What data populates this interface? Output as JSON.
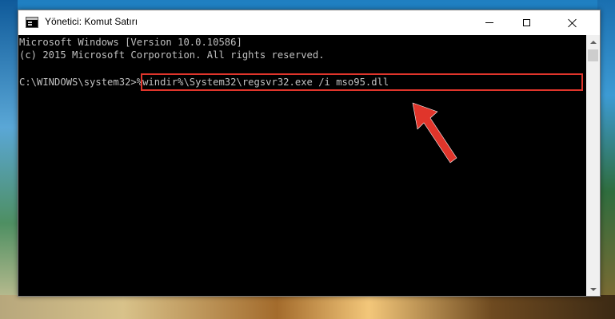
{
  "window": {
    "title": "Yönetici: Komut Satırı"
  },
  "console": {
    "lines": [
      "Microsoft Windows [Version 10.0.10586]",
      "(c) 2015 Microsoft Corporotion. All rights reserved."
    ],
    "prompt": "C:\\WINDOWS\\system32>",
    "command": "%windir%\\System32\\regsvr32.exe /i mso95.dll"
  },
  "colors": {
    "console_bg": "#000000",
    "console_text": "#c0c0c0",
    "highlight": "#e0352b",
    "arrow": "#e0352b"
  },
  "icons": {
    "app": "cmd-icon",
    "minimize": "minimize-icon",
    "maximize": "maximize-icon",
    "close": "close-icon",
    "annotation": "arrow-icon"
  }
}
